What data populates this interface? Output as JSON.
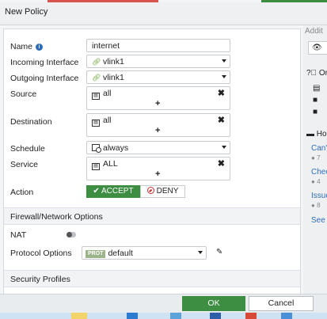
{
  "dialog": {
    "title": "New Policy"
  },
  "form": {
    "name_label": "Name",
    "name_value": "internet",
    "incoming_label": "Incoming Interface",
    "incoming_value": "vlink1",
    "outgoing_label": "Outgoing Interface",
    "outgoing_value": "vlink1",
    "source_label": "Source",
    "source_value": "all",
    "destination_label": "Destination",
    "destination_value": "all",
    "schedule_label": "Schedule",
    "schedule_value": "always",
    "service_label": "Service",
    "service_value": "ALL",
    "action_label": "Action",
    "accept_label": "ACCEPT",
    "deny_label": "DENY",
    "add_symbol": "+",
    "remove_symbol": "✖"
  },
  "sections": {
    "firewall_title": "Firewall/Network Options",
    "nat_label": "NAT",
    "nat_enabled": false,
    "protocol_label": "Protocol Options",
    "protocol_badge": "PROT",
    "protocol_value": "default",
    "security_title": "Security Profiles"
  },
  "side_panel": {
    "heading": "Addit",
    "online_heading": "Or",
    "help_heading": "Ho",
    "link1": "Can'",
    "link1_count": "7",
    "link2": "Chec",
    "link2_count": "4",
    "link3": "Issue",
    "link3_count": "8",
    "see_more": "See N"
  },
  "footer": {
    "ok_label": "OK",
    "cancel_label": "Cancel"
  },
  "colors": {
    "accent_green": "#3d8d43",
    "deny_red": "#c9302c",
    "link_blue": "#2f6db8"
  }
}
